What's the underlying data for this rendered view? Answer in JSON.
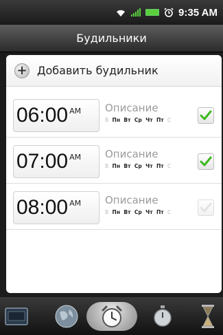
{
  "status_bar": {
    "time": "9:35 AM"
  },
  "title_bar": {
    "title": "Будильники"
  },
  "add_alarm": {
    "label": "Добавить будильник"
  },
  "alarms": [
    {
      "time": "06:00",
      "ampm": "AM",
      "description": "Описание",
      "days": [
        {
          "label": "В",
          "active": false
        },
        {
          "label": "Пн",
          "active": true
        },
        {
          "label": "Вт",
          "active": true
        },
        {
          "label": "Ср",
          "active": true
        },
        {
          "label": "Чт",
          "active": true
        },
        {
          "label": "Пт",
          "active": true
        },
        {
          "label": "С",
          "active": false
        }
      ],
      "enabled": true
    },
    {
      "time": "07:00",
      "ampm": "AM",
      "description": "Описание",
      "days": [
        {
          "label": "В",
          "active": false
        },
        {
          "label": "Пн",
          "active": true
        },
        {
          "label": "Вт",
          "active": true
        },
        {
          "label": "Ср",
          "active": true
        },
        {
          "label": "Чт",
          "active": true
        },
        {
          "label": "Пт",
          "active": true
        },
        {
          "label": "С",
          "active": false
        }
      ],
      "enabled": true
    },
    {
      "time": "08:00",
      "ampm": "AM",
      "description": "Описание",
      "days": [
        {
          "label": "В",
          "active": false
        },
        {
          "label": "Пн",
          "active": true
        },
        {
          "label": "Вт",
          "active": true
        },
        {
          "label": "Ср",
          "active": true
        },
        {
          "label": "Чт",
          "active": true
        },
        {
          "label": "Пт",
          "active": true
        },
        {
          "label": "С",
          "active": false
        }
      ],
      "enabled": false
    }
  ],
  "bottom_tabs": [
    {
      "icon": "desk-clock-icon",
      "selected": false
    },
    {
      "icon": "world-clock-icon",
      "selected": false
    },
    {
      "icon": "alarm-clock-icon",
      "selected": true
    },
    {
      "icon": "stopwatch-icon",
      "selected": false
    },
    {
      "icon": "timer-icon",
      "selected": false
    }
  ],
  "colors": {
    "check_green": "#3cb81c",
    "battery_green": "#5ccf3f",
    "active_day": "#222222",
    "inactive_day": "#bbbbbb"
  }
}
